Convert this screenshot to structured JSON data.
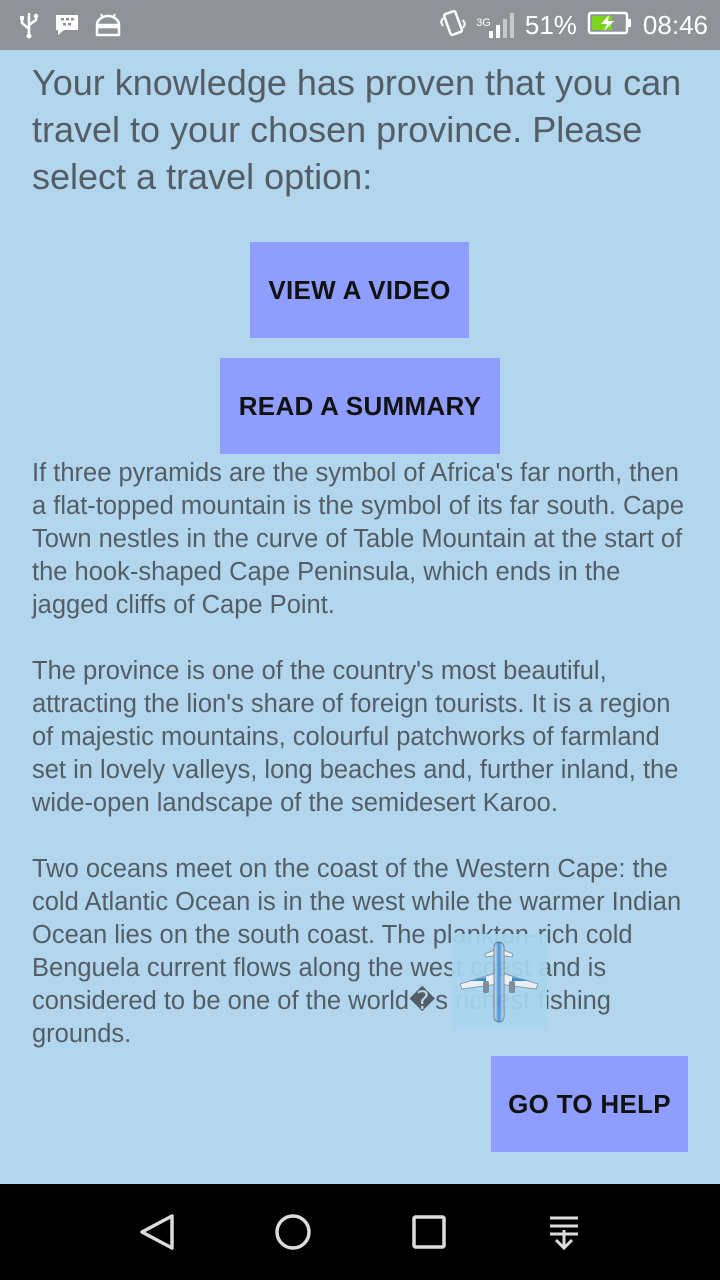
{
  "status_bar": {
    "network_type": "3G",
    "battery_percent": "51%",
    "time": "08:46",
    "left_icons": [
      "usb-icon",
      "bbm-icon",
      "android-icon"
    ],
    "right_icons": [
      "vibrate-icon",
      "signal-icon",
      "battery-charging-icon"
    ]
  },
  "main": {
    "heading": "Your knowledge has proven that you can travel to your chosen province. Please select a travel option:",
    "view_video_label": "VIEW A VIDEO",
    "read_summary_label": "READ A SUMMARY",
    "summary_text": "If three pyramids are the symbol of Africa's far north, then a flat-topped mountain is the symbol of its far south. Cape Town nestles in the curve of Table Mountain at the start of the hook-shaped Cape Peninsula, which ends in the jagged cliffs of Cape Point.\n\nThe province is one of the country's most beautiful, attracting the lion's share of foreign tourists. It is a region of majestic mountains, colourful patchworks of farmland set in lovely valleys, long beaches and, further inland, the wide-open landscape of the semidesert Karoo.\n\nTwo oceans meet on the coast of the Western Cape: the cold Atlantic Ocean is in the west while the warmer Indian Ocean lies on the south coast. The plankton-rich cold Benguela current flows along the west coast and is considered to be one of the world�s richest fishing grounds.",
    "go_to_help_label": "GO TO HELP",
    "floating_icon": "airplane-icon"
  },
  "nav_bar": {
    "icons": [
      "back-icon",
      "home-icon",
      "recents-icon",
      "notification-drawer-icon"
    ]
  },
  "colors": {
    "background": "#b2d6ee",
    "button": "#8f9efe",
    "text": "#555d64",
    "status_bar": "#8f9398",
    "battery_charge": "#7ed321"
  }
}
